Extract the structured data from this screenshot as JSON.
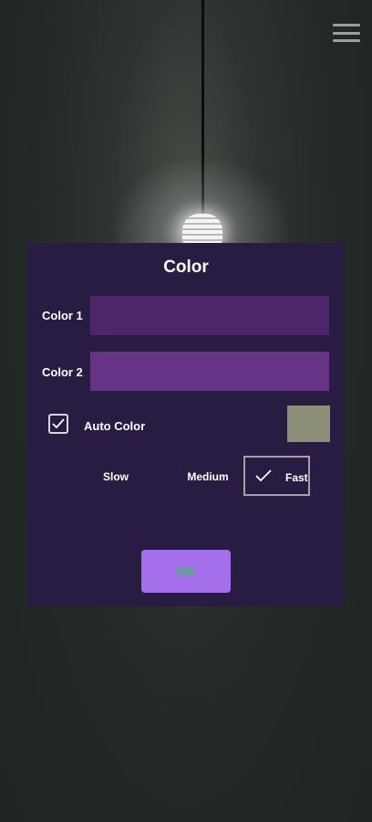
{
  "dialog": {
    "title": "Color",
    "color1": {
      "label": "Color 1",
      "value": "#4d2569"
    },
    "color2": {
      "label": "Color 2",
      "value": "#673387"
    },
    "auto_color": {
      "label": "Auto Color",
      "checked": true
    },
    "preview_color": "#8d8e78",
    "speed": {
      "options": [
        "Slow",
        "Medium",
        "Fast"
      ],
      "selected": "Fast"
    },
    "ok_label": "OK"
  },
  "colors": {
    "dialog_bg": "#281c43",
    "ok_bg": "#a56eea",
    "ok_text": "#36c15a"
  },
  "icons": {
    "menu": "hamburger-menu-icon",
    "checkbox_mark": "checkmark-icon",
    "speed_mark": "checkmark-icon"
  }
}
